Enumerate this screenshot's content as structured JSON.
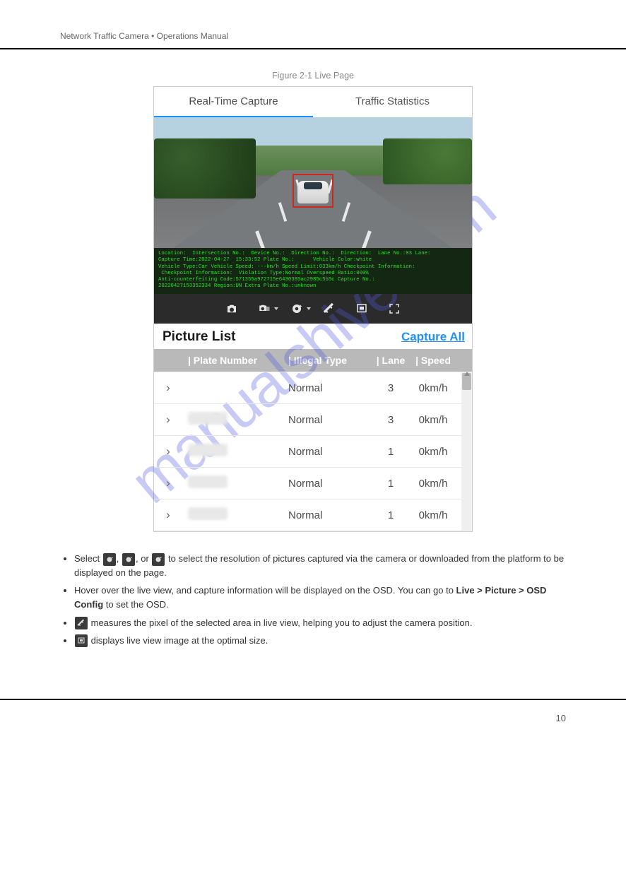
{
  "doc": {
    "header_left": "Network Traffic Camera • Operations Manual",
    "footer_brand": "",
    "page_number": "10"
  },
  "figure": {
    "caption": "Figure 2-1 Live Page",
    "tabs": {
      "active": "Real-Time Capture",
      "secondary": "Traffic Statistics"
    },
    "osd": "Location:  Intersection No.:  Device No.:  Direction No.:  Direction:  Lane No.:03 Lane:\nCapture Time:2022-04-27  15:33:52 Plate No.:      Vehicle Color:white\nVehicle Type:Car Vehicle Speed: ---km/h Speed Limit:033km/h Checkpoint Information:\n Checkpoint Information:  Violation Type:Normal Overspeed Ratio:000%\nAnti-counterfeiting Code:571355a972715e6430385ac2985c5b5c Capture No.:\n20220427153352334 Region:UN Extra Plate No.:unknown",
    "toolbar": {
      "snapshot": "snapshot-icon",
      "continuous": "continuous-snapshot-icon",
      "record": "record-icon",
      "measure": "measure-icon",
      "optimal": "optimal-display-icon",
      "fullscreen": "fullscreen-icon"
    },
    "picture_list": {
      "title": "Picture List",
      "capture_all": "Capture All",
      "columns": [
        "| Plate Number",
        "| Illegal Type",
        "| Lane",
        "| Speed"
      ],
      "rows": [
        {
          "plate": "",
          "illegal": "Normal",
          "lane": "3",
          "speed": "0km/h",
          "blurred": false
        },
        {
          "plate": "",
          "illegal": "Normal",
          "lane": "3",
          "speed": "0km/h",
          "blurred": true
        },
        {
          "plate": "",
          "illegal": "Normal",
          "lane": "1",
          "speed": "0km/h",
          "blurred": true
        },
        {
          "plate": "",
          "illegal": "Normal",
          "lane": "1",
          "speed": "0km/h",
          "blurred": true
        },
        {
          "plate": "",
          "illegal": "Normal",
          "lane": "1",
          "speed": "0km/h",
          "blurred": true
        }
      ]
    }
  },
  "copy": {
    "b1_prefix": "Select ",
    "b1_suffix": " to select the resolution of pictures captured via the camera or downloaded from the platform to be displayed on the page.",
    "b2": "Hover over the live view, and capture information will be displayed on the OSD. You can go to ",
    "b2_path": "Live > Picture > OSD Config",
    "b2_after": " to set the OSD.",
    "b3": " measures the pixel of the selected area in live view, helping you to adjust the camera position.",
    "b4": " displays live view image at the optimal size."
  },
  "watermark": "manualshive.com"
}
